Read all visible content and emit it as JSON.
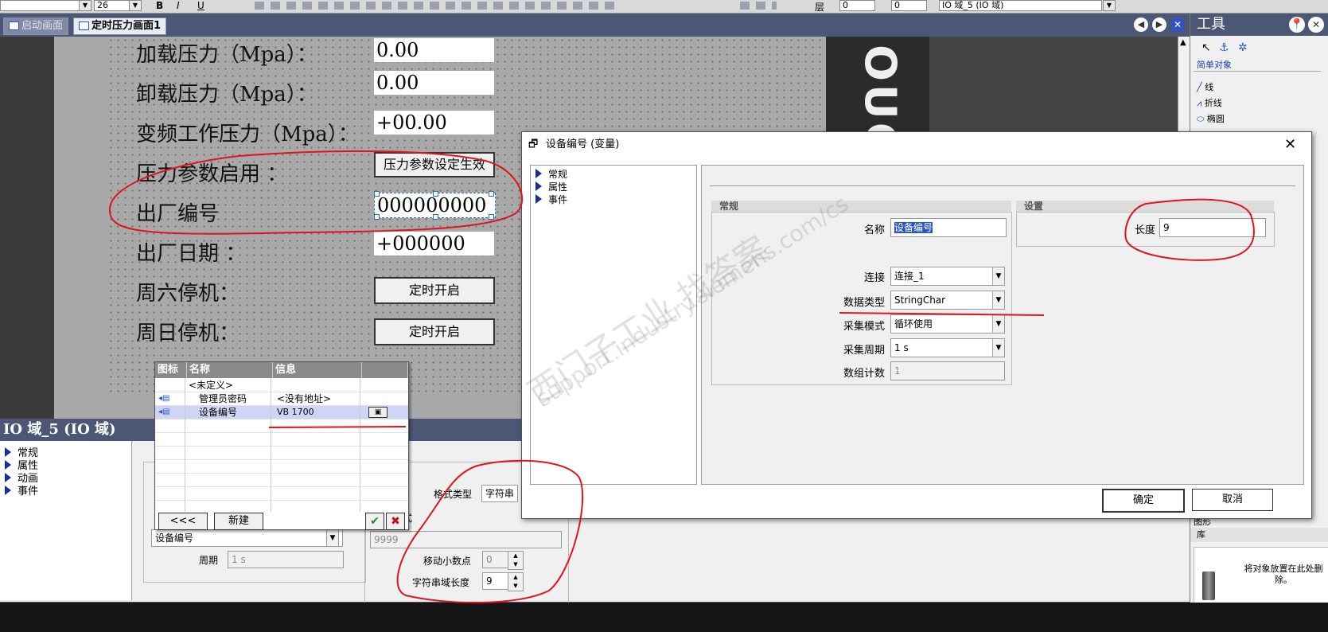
{
  "toolbar": {
    "font_size": "26",
    "label_layer": "层",
    "layer_value": "0",
    "layer_value_2": "0",
    "object_select": "IO 域_5 (IO 域)"
  },
  "tabs": [
    {
      "label": "启动画面"
    },
    {
      "label": "定时压力画面1"
    }
  ],
  "screen": {
    "labels": [
      "加载压力（Mpa）：",
      "卸载压力（Mpa）：",
      "变频工作压力（Mpa）：",
      "压力参数启用 ：",
      "出厂编号",
      "出厂日期 ：",
      "周六停机：",
      "周日停机："
    ],
    "fields": {
      "load": "0.00",
      "unload": "0.00",
      "vfd": "+00.00",
      "serial": "000000000",
      "date": "+000000"
    },
    "buttons": {
      "pressure_enable": "压力参数设定生效",
      "saturday": "定时开启",
      "sunday": "定时开启"
    },
    "side_text": "OUC"
  },
  "tools": {
    "title": "工具",
    "section_simple": "简单对象",
    "items": [
      "线",
      "折线",
      "椭圆"
    ],
    "graphics_label": "图形",
    "library_label": "库",
    "drop_hint": "将对象放置在此处删除。"
  },
  "property_panel": {
    "title": "IO 域_5 (IO 域)",
    "nav": [
      "常规",
      "属性",
      "动画",
      "事件"
    ],
    "variable_value": "设备编号",
    "cycle_label": "周期",
    "cycle_value": "1 s",
    "format_type_label": "格式类型",
    "format_type_value": "字符串",
    "format_label": "格式",
    "format_value": "9999",
    "decimal_label": "移动小数点",
    "decimal_value": "0",
    "strlen_label": "字符串域长度",
    "strlen_value": "9"
  },
  "popup": {
    "headers": [
      "图标",
      "名称",
      "信息"
    ],
    "rows": [
      {
        "name": "<未定义>",
        "info": ""
      },
      {
        "name": "管理员密码",
        "info": "<没有地址>"
      },
      {
        "name": "设备编号",
        "info": "VB 1700"
      }
    ],
    "back_button": "<<<",
    "new_button": "新建"
  },
  "dialog": {
    "title": "设备编号 (变量)",
    "nav": [
      "常规",
      "属性",
      "事件"
    ],
    "group_general": "常规",
    "group_settings": "设置",
    "name_label": "名称",
    "name_value": "设备编号",
    "length_label": "长度",
    "length_value": "9",
    "connection_label": "连接",
    "connection_value": "连接_1",
    "datatype_label": "数据类型",
    "datatype_value": "StringChar",
    "mode_label": "采集模式",
    "mode_value": "循环使用",
    "cycle_label": "采集周期",
    "cycle_value": "1 s",
    "array_label": "数组计数",
    "array_value": "1",
    "ok_button": "确定",
    "cancel_button": "取消"
  },
  "watermark": {
    "line1": "西门子工业  找答案",
    "line2": "support.industry.siemens.com/cs"
  },
  "colors": {
    "annotation_red": "#e0141e",
    "title_bar": "#4b5775",
    "nav_triangle": "#1a2f9a"
  }
}
